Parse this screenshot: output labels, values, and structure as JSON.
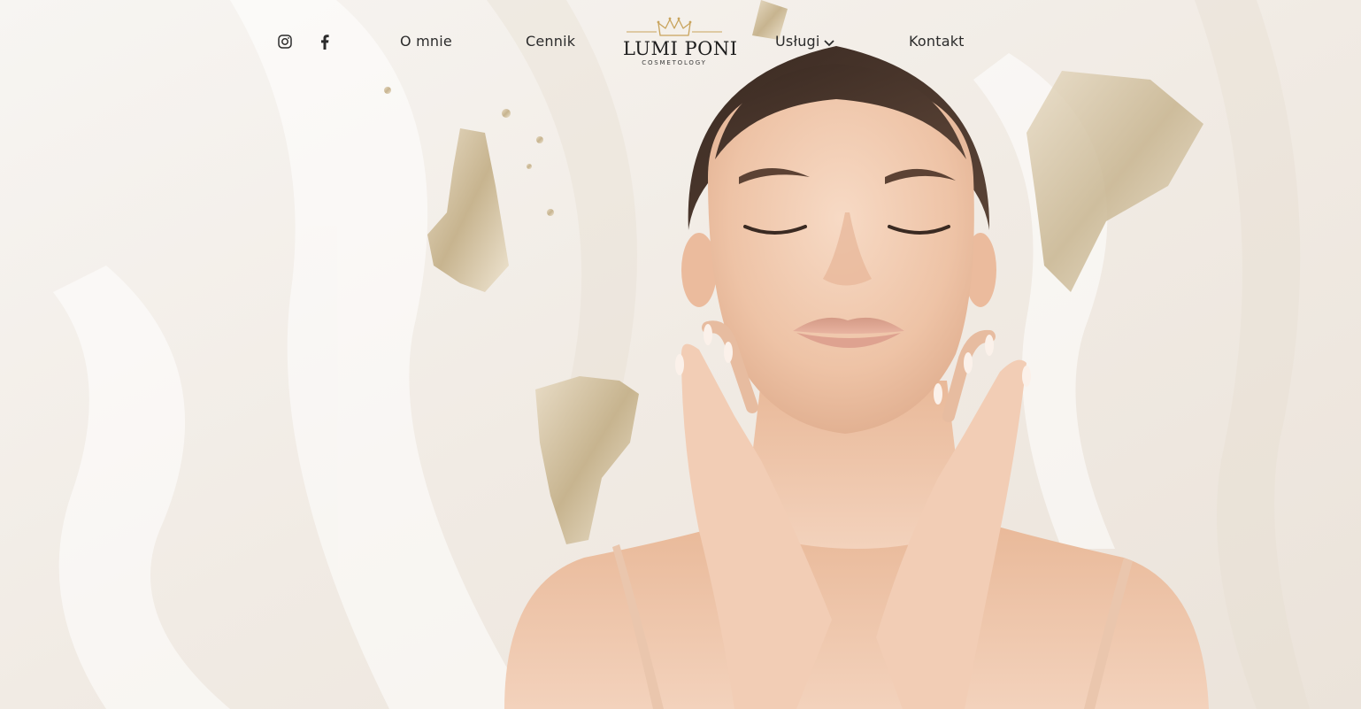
{
  "nav": {
    "social": [
      {
        "icon": "instagram-icon"
      },
      {
        "icon": "facebook-icon"
      }
    ],
    "links": {
      "about": "O mnie",
      "pricing": "Cennik",
      "services": "Usługi",
      "contact": "Kontakt"
    },
    "logo": {
      "name": "LUMI PONI",
      "tagline": "COSMETOLOGY"
    }
  },
  "colors": {
    "gold": "#c9a45c",
    "text": "#2b2b2b",
    "background": "#f4f0ec",
    "skin": "#f1cdb4"
  }
}
